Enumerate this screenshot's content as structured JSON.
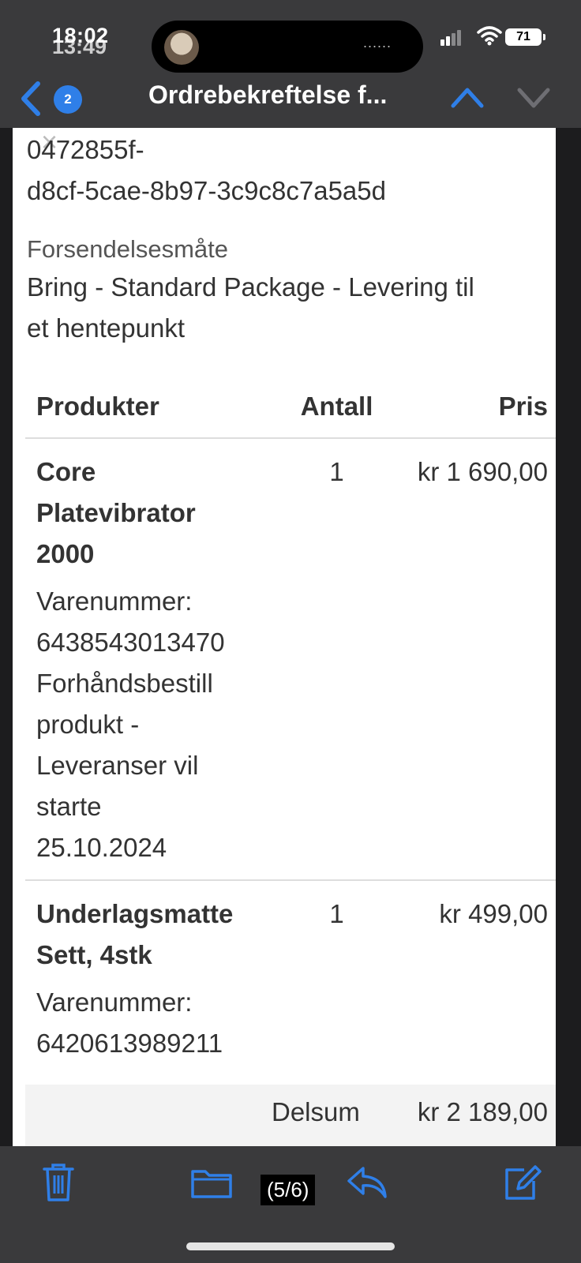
{
  "status": {
    "time": "18:02",
    "time_overlay": "13:49",
    "battery": "71",
    "island_dots": "......"
  },
  "nav": {
    "badge": "2",
    "title": "Ordrebekreftelse f..."
  },
  "content": {
    "order_id": [
      "0472855f-",
      "d8cf-5cae-8b97-3c9c8c7a5a5d"
    ],
    "shipping_label": "Forsendelsesmåte",
    "shipping_value": [
      "Bring - Standard Package - Levering til",
      "et hentepunkt"
    ],
    "table": {
      "headers": {
        "product": "Produkter",
        "qty": "Antall",
        "price": "Pris"
      },
      "rows": [
        {
          "name_lines": [
            "Core",
            "Platevibrator",
            "2000"
          ],
          "sku_label": "Varenummer:",
          "sku": "6438543013470",
          "note_lines": [
            "Forhåndsbestill",
            "produkt -",
            "Leveranser vil",
            "starte",
            "25.10.2024"
          ],
          "qty": "1",
          "price": "kr 1 690,00"
        },
        {
          "name_lines": [
            "Underlagsmatte",
            "Sett, 4stk"
          ],
          "sku_label": "Varenummer:",
          "sku": "6420613989211",
          "qty": "1",
          "price": "kr 499,00"
        }
      ],
      "subtotal_label": "Delsum",
      "subtotal_value": "kr 2 189,00"
    }
  },
  "toolbar": {
    "page_counter": "(5/6)"
  },
  "colors": {
    "accent": "#2f7fe8",
    "bar": "#3a3a3c"
  }
}
